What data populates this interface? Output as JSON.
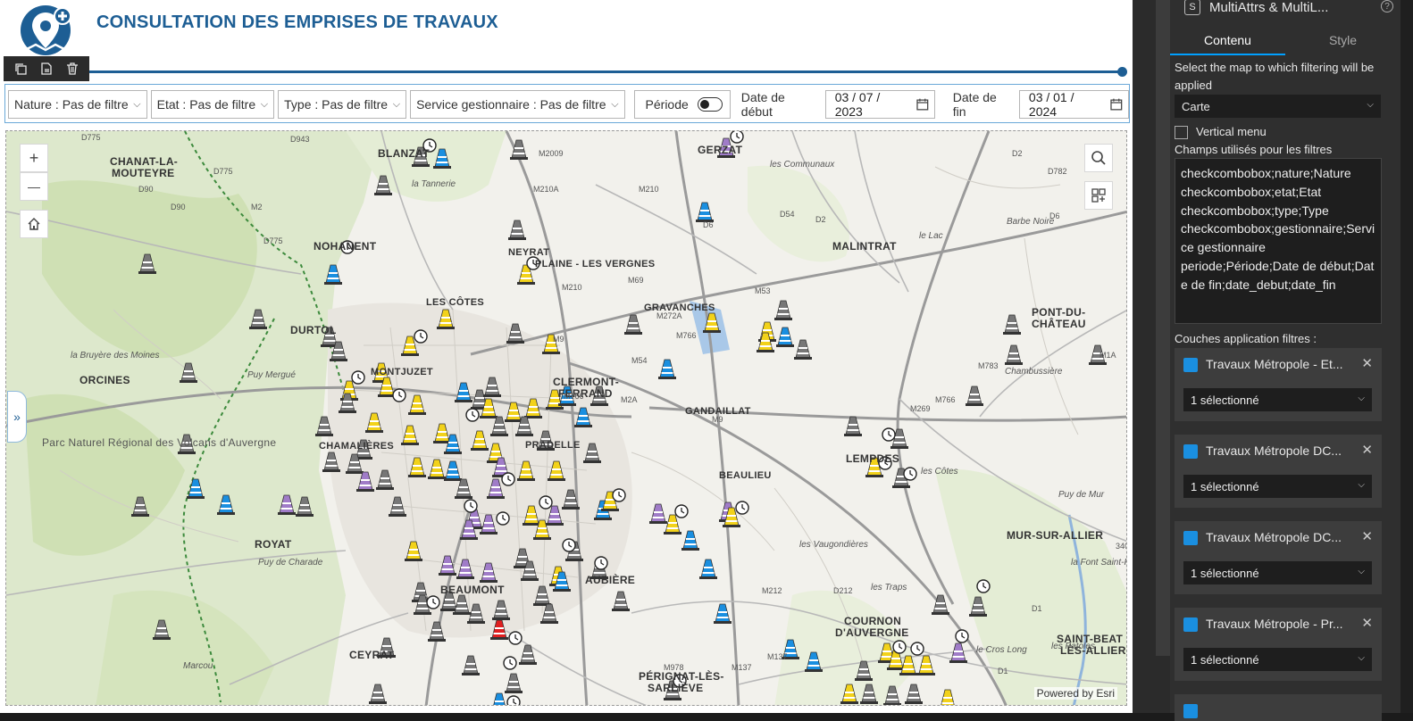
{
  "app": {
    "title": "CONSULTATION DES EMPRISES DE TRAVAUX",
    "widget_toolbar": [
      "copy-icon",
      "duplicate-page-icon",
      "trash-icon"
    ]
  },
  "filters": {
    "nature": "Nature : Pas de filtre",
    "etat": "Etat : Pas de filtre",
    "type": "Type : Pas de filtre",
    "service": "Service gestionnaire : Pas de filtre",
    "periode_label": "Période",
    "periode_on": false,
    "date_debut_label": "Date de début",
    "date_debut": "03 / 07 / 2023",
    "date_fin_label": "Date de fin",
    "date_fin": "03 / 01 / 2024"
  },
  "map": {
    "powered_by": "Powered by Esri",
    "controls": {
      "zoom_in": "+",
      "zoom_out": "—"
    },
    "places": [
      {
        "label": "CHANAT-LA-",
        "cls": "big"
      },
      {
        "label": "MOUTEYRE",
        "cls": "big"
      },
      {
        "label": "BLANZAT",
        "cls": "big"
      },
      {
        "label": "GERZAT",
        "cls": "big"
      },
      {
        "label": "NOHANENT",
        "cls": "big"
      },
      {
        "label": "MALINTRAT",
        "cls": "big"
      },
      {
        "label": "DURTOL",
        "cls": "big"
      },
      {
        "label": "ORCINES",
        "cls": "big"
      },
      {
        "label": "CLERMONT-",
        "cls": "big"
      },
      {
        "label": "FERRAND",
        "cls": "big"
      },
      {
        "label": "PONT-DU-",
        "cls": "big"
      },
      {
        "label": "CHÂTEAU",
        "cls": "big"
      },
      {
        "label": "ROYAT",
        "cls": "big"
      },
      {
        "label": "MUR-SUR-ALLIER",
        "cls": "big"
      },
      {
        "label": "COURNON",
        "cls": "big"
      },
      {
        "label": "D'AUVERGNE",
        "cls": "big"
      },
      {
        "label": "BEAUMONT",
        "cls": "big"
      },
      {
        "label": "CEYRAT",
        "cls": "big"
      },
      {
        "label": "AUBIÈRE",
        "cls": "big"
      },
      {
        "label": "PÉRIGNAT-LÈS-",
        "cls": "big"
      },
      {
        "label": "SARLIÈVE",
        "cls": "big"
      },
      {
        "label": "SAINT-BEAT",
        "cls": "big"
      },
      {
        "label": "LÈS-ALLIER",
        "cls": "big"
      },
      {
        "label": "LEMPDES",
        "cls": "big"
      },
      {
        "label": "GRAVANCHES",
        "cls": ""
      },
      {
        "label": "GANDAILLAT",
        "cls": ""
      },
      {
        "label": "BEAULIEU",
        "cls": ""
      },
      {
        "label": "PRADELLE",
        "cls": ""
      },
      {
        "label": "NEYRAT",
        "cls": ""
      },
      {
        "label": "PLAINE - LES VERGNES",
        "cls": ""
      },
      {
        "label": "MONTJUZET",
        "cls": ""
      },
      {
        "label": "CHAMALIÈRES",
        "cls": ""
      },
      {
        "label": "LES CÔTES",
        "cls": ""
      },
      {
        "label": "la Tannerie",
        "cls": "minor"
      },
      {
        "label": "les Communaux",
        "cls": "minor"
      },
      {
        "label": "Barbe Noire",
        "cls": "minor"
      },
      {
        "label": "le Lac",
        "cls": "minor"
      },
      {
        "label": "la Bruyère des Moines",
        "cls": "minor"
      },
      {
        "label": "Puy Mergué",
        "cls": "minor"
      },
      {
        "label": "Chambussière",
        "cls": "minor"
      },
      {
        "label": "les Côtes",
        "cls": "minor"
      },
      {
        "label": "Puy de Mur",
        "cls": "minor"
      },
      {
        "label": "les Vaugondières",
        "cls": "minor"
      },
      {
        "label": "la Font Saint-Pierre",
        "cls": "minor"
      },
      {
        "label": "Puy de Charade",
        "cls": "minor"
      },
      {
        "label": "les Traps",
        "cls": "minor"
      },
      {
        "label": "les Patoles",
        "cls": "minor"
      },
      {
        "label": "Marcou",
        "cls": "minor"
      },
      {
        "label": "le Cros Long",
        "cls": "minor"
      },
      {
        "label": "Parc Naturel Régional des Volcans d'Auvergne",
        "cls": "park"
      }
    ],
    "roads": [
      "D775",
      "D943",
      "D90",
      "D775",
      "D775",
      "D90",
      "M2",
      "M2009",
      "M210A",
      "M210",
      "M9",
      "D6",
      "D2",
      "D54",
      "D2",
      "D782",
      "D6",
      "M69",
      "M272A",
      "M53",
      "M210",
      "M54",
      "M766",
      "M2A",
      "M766",
      "M9",
      "M766",
      "M269",
      "M783",
      "D212",
      "M1A",
      "M137",
      "M212",
      "M978",
      "M137",
      "D1",
      "D1",
      "340"
    ]
  },
  "panel": {
    "widget_name": "MultiAttrs & MultiL...",
    "tabs": [
      "Contenu",
      "Style"
    ],
    "active_tab": "Contenu",
    "map_select_label": "Select the map to which filtering will be applied",
    "map_select_value": "Carte",
    "vertical_menu_label": "Vertical menu",
    "vertical_menu_checked": false,
    "fields_label": "Champs utilisés pour les filtres",
    "fields_text": "checkcombobox;nature;Nature\ncheckcombobox;etat;Etat\ncheckcombobox;type;Type\ncheckcombobox;gestionnaire;Service gestionnaire\nperiode;Période;Date de début;Date de fin;date_debut;date_fin",
    "layers_label": "Couches application filtres :",
    "layers": [
      {
        "name": "Travaux Métropole - Et...",
        "selection": "1 sélectionné"
      },
      {
        "name": "Travaux Métropole DC...",
        "selection": "1 sélectionné"
      },
      {
        "name": "Travaux Métropole DC...",
        "selection": "1 sélectionné"
      },
      {
        "name": "Travaux Métropole - Pr...",
        "selection": "1 sélectionné"
      }
    ]
  },
  "colors": {
    "brand": "#1d5e94",
    "marker_gray": "#777777",
    "marker_yellow": "#f2d21a",
    "marker_blue": "#1a8fe0",
    "marker_purple": "#a07cc8",
    "marker_red": "#e02020",
    "panel_bg": "#2f2f2f",
    "tab_accent": "#00a0ff"
  }
}
